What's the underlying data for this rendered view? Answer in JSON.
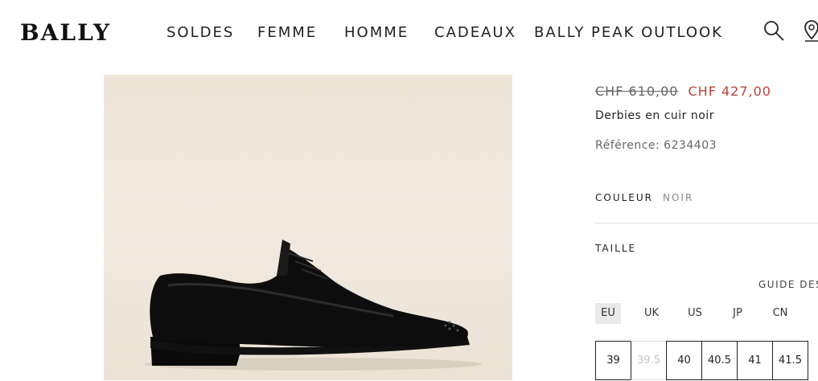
{
  "header": {
    "logo": "BALLY",
    "nav": [
      {
        "label": "SOLDES"
      },
      {
        "label": "FEMME"
      },
      {
        "label": "HOMME"
      },
      {
        "label": "CADEAUX"
      },
      {
        "label": "BALLY PEAK OUTLOOK"
      }
    ],
    "icons": [
      "search-icon",
      "store-locator-icon"
    ]
  },
  "product": {
    "price_old": "CHF 610,00",
    "price_new": "CHF 427,00",
    "name": "Derbies en cuir noir",
    "reference": "Référence: 6234403",
    "colour_label": "COULEUR",
    "colour_value": "NOIR",
    "size_label": "TAILLE",
    "size_guide": "GUIDE DES",
    "size_systems": [
      {
        "label": "EU",
        "active": true
      },
      {
        "label": "UK",
        "active": false
      },
      {
        "label": "US",
        "active": false
      },
      {
        "label": "JP",
        "active": false
      },
      {
        "label": "CN",
        "active": false
      }
    ],
    "sizes": [
      {
        "label": "39",
        "available": true
      },
      {
        "label": "39.5",
        "available": false
      },
      {
        "label": "40",
        "available": true
      },
      {
        "label": "40.5",
        "available": true
      },
      {
        "label": "41",
        "available": true
      },
      {
        "label": "41.5",
        "available": true
      }
    ]
  },
  "colors": {
    "sale_price": "#b8423a",
    "image_background": "#efe6da",
    "shoe": "#0d0d0d"
  }
}
